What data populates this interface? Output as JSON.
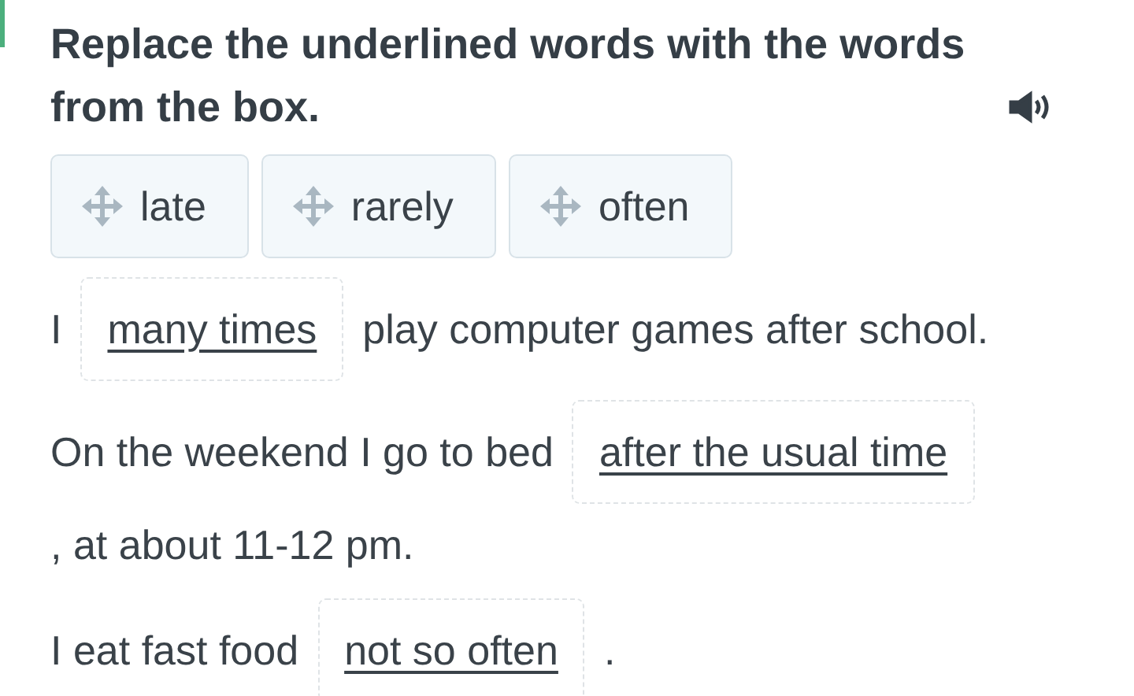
{
  "instruction": {
    "text": "Replace the underlined words with the words from the box."
  },
  "word_box": [
    {
      "label": "late"
    },
    {
      "label": "rarely"
    },
    {
      "label": "often"
    }
  ],
  "sentences": [
    {
      "parts": [
        {
          "kind": "text",
          "text": "I"
        },
        {
          "kind": "gap",
          "text": "many times"
        },
        {
          "kind": "text",
          "text": "play computer games after school."
        }
      ]
    },
    {
      "parts": [
        {
          "kind": "text",
          "text": "On the weekend I go to bed"
        },
        {
          "kind": "gap",
          "text": "after the usual time"
        },
        {
          "kind": "text",
          "text": ", at about 11-12 pm."
        }
      ]
    },
    {
      "parts": [
        {
          "kind": "text",
          "text": "I eat fast food"
        },
        {
          "kind": "gap",
          "text": "not so often"
        },
        {
          "kind": "text",
          "text": "."
        }
      ]
    }
  ]
}
